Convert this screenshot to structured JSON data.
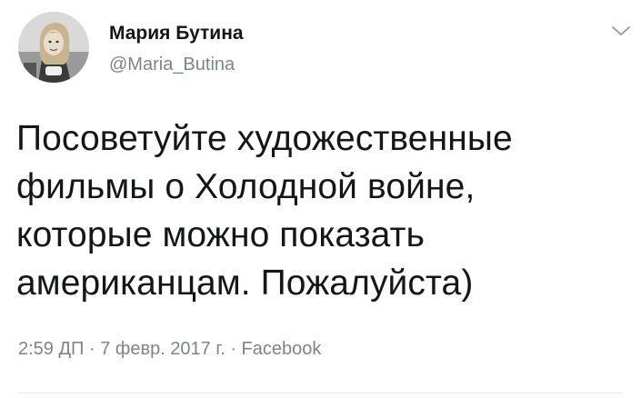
{
  "author": {
    "name": "Мария Бутина",
    "handle": "@Maria_Butina"
  },
  "icons": {
    "menu": "chevron-down-icon",
    "avatar": "profile-photo"
  },
  "tweet": {
    "lines": [
      "Посоветуйте художественные",
      "фильмы о Холодной войне,",
      "которые можно показать",
      "американцам. Пожалуйста)"
    ]
  },
  "meta": {
    "time": "2:59 ДП",
    "separator1": " · ",
    "date": "7 февр. 2017 г.",
    "separator2": " · ",
    "source": "Facebook"
  },
  "colors": {
    "text": "#14171a",
    "secondary": "#7a8590",
    "divider": "#e1e8ed"
  }
}
